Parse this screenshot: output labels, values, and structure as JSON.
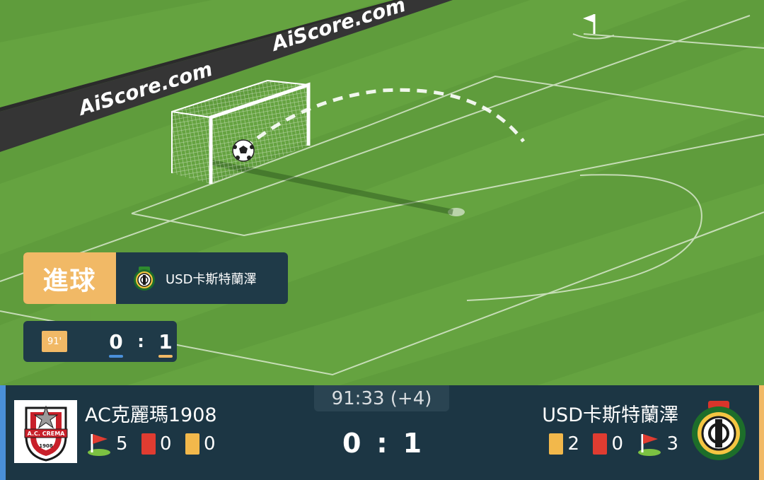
{
  "banner": {
    "brand_1": "AiScore.com",
    "brand_2": "AiScore.com"
  },
  "event": {
    "tag": "進球",
    "team_name": "USD卡斯特蘭澤"
  },
  "mini_score": {
    "minute": "91'",
    "home": "0",
    "separator": ":",
    "away": "1"
  },
  "match": {
    "clock": "91:33 (+4)",
    "home": {
      "name": "AC克麗瑪1908",
      "corners": "5",
      "red_cards": "0",
      "yellow_cards": "0",
      "logo_text": "A.C. CREMA",
      "logo_year": "1908"
    },
    "away": {
      "name": "USD卡斯特蘭澤",
      "yellow_cards": "2",
      "red_cards": "0",
      "corners": "3"
    },
    "score": {
      "home": "0",
      "separator": ":",
      "away": "1"
    }
  },
  "colors": {
    "home_accent": "#4a90d9",
    "away_accent": "#f1b966",
    "panel": "#1c3644",
    "pitch": "#5d9a3a"
  },
  "icons": [
    "soccer-ball-icon",
    "corner-flag-icon",
    "red-card-icon",
    "yellow-card-icon",
    "team-crest-icon"
  ]
}
